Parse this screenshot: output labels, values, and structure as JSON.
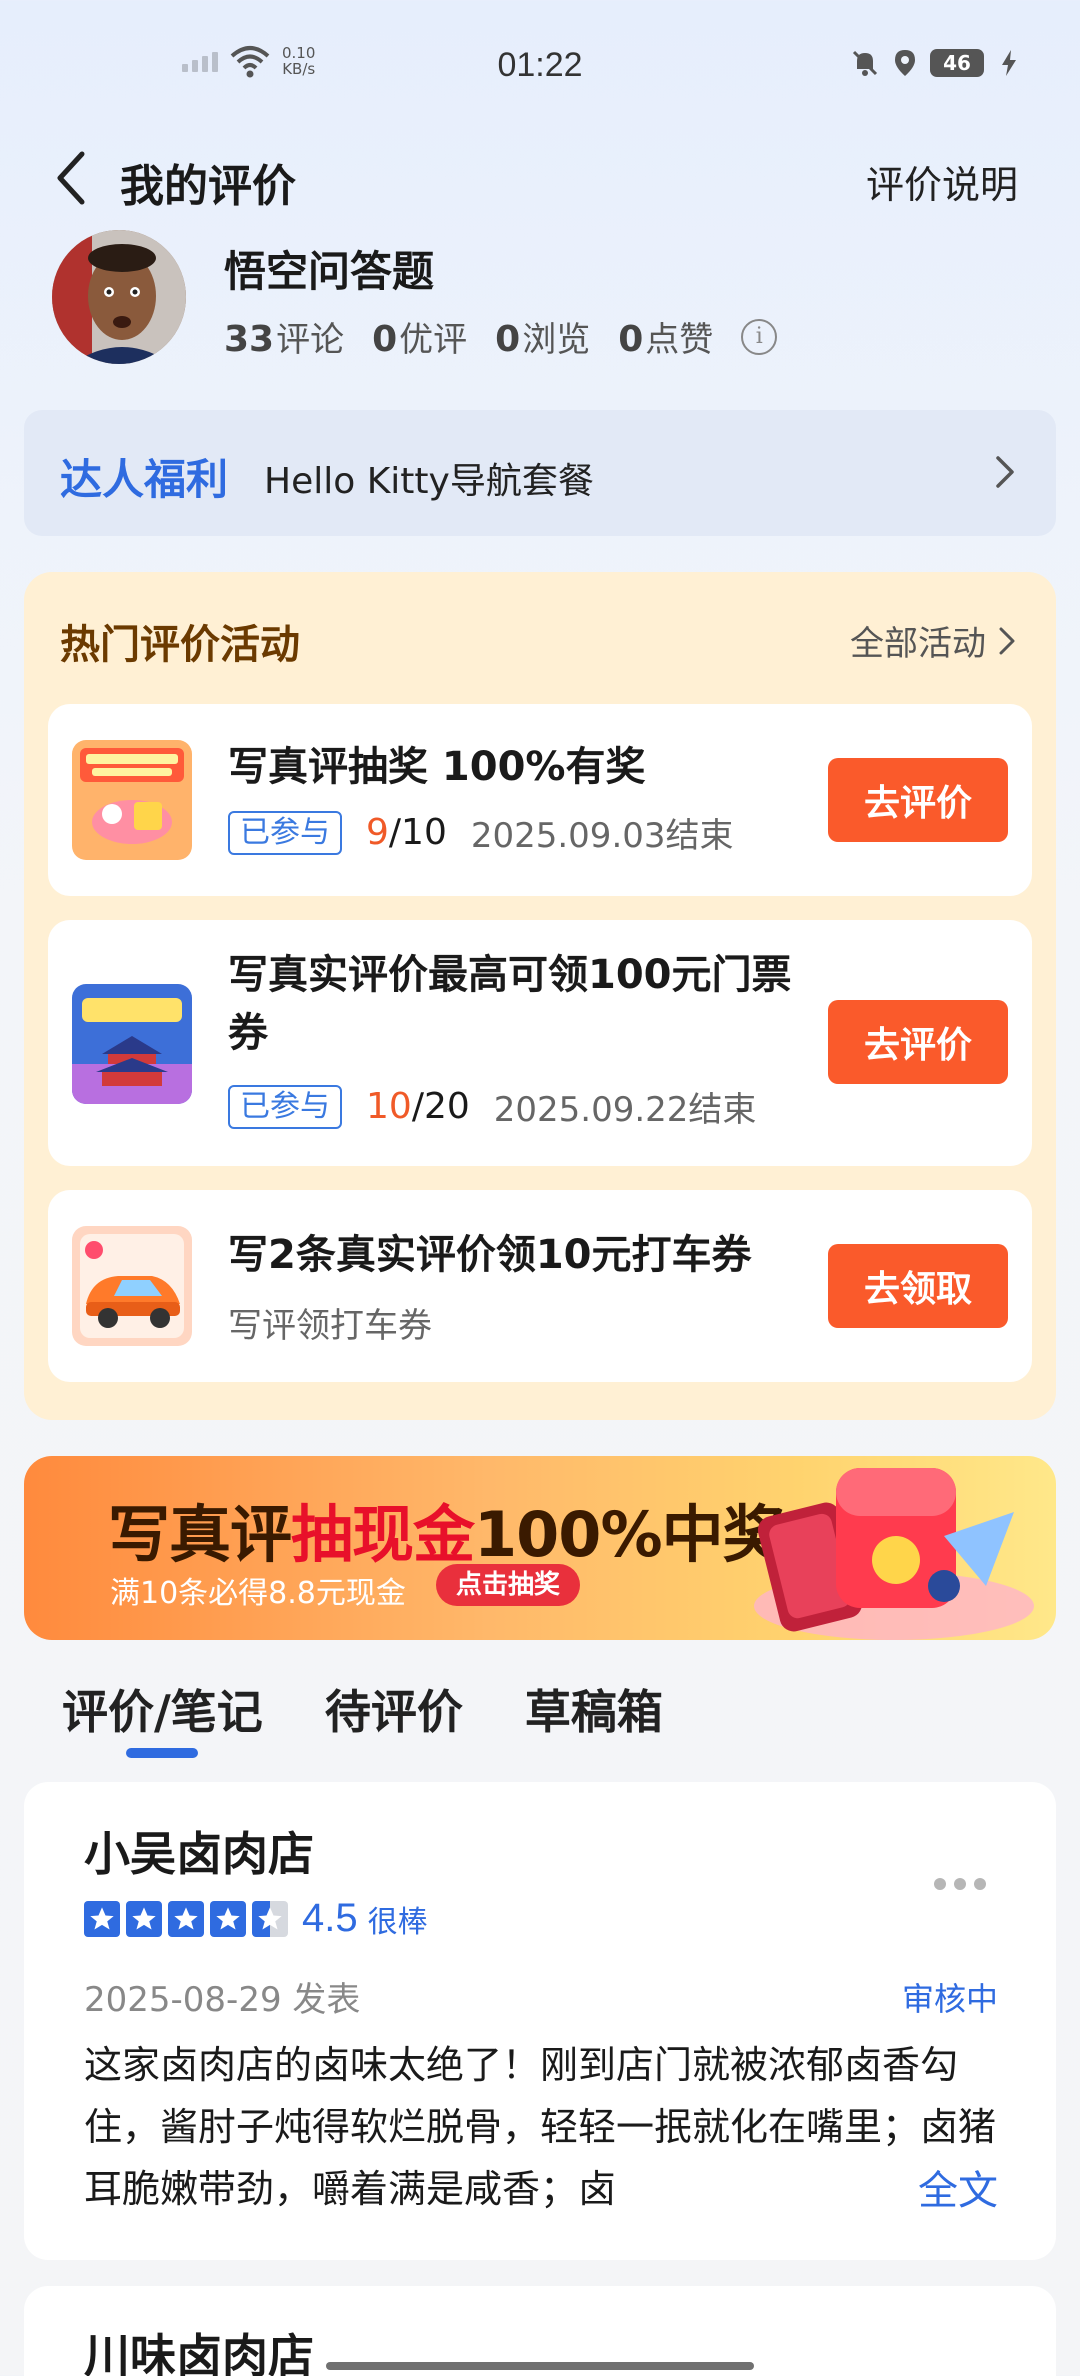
{
  "status_bar": {
    "time": "01:22",
    "net_speed_value": "0.10",
    "net_speed_unit": "KB/s",
    "battery": "46"
  },
  "navbar": {
    "title": "我的评价",
    "help_link": "评价说明"
  },
  "profile": {
    "name": "悟空问答题",
    "stats": [
      {
        "count": "33",
        "label": "评论"
      },
      {
        "count": "0",
        "label": "优评"
      },
      {
        "count": "0",
        "label": "浏览"
      },
      {
        "count": "0",
        "label": "点赞"
      }
    ]
  },
  "benefit": {
    "label": "达人福利",
    "text": "Hello Kitty导航套餐"
  },
  "activities": {
    "title": "热门评价活动",
    "all_link": "全部活动",
    "items": [
      {
        "name": "写真评抽奖 100%有奖",
        "tag": "已参与",
        "progress_current": "9",
        "progress_total": "/10",
        "deadline": "2025.09.03结束",
        "button": "去评价"
      },
      {
        "name": "写真实评价最高可领100元门票券",
        "tag": "已参与",
        "progress_current": "10",
        "progress_total": "/20",
        "deadline": "2025.09.22结束",
        "button": "去评价"
      },
      {
        "name": "写2条真实评价领10元打车券",
        "subtitle": "写评领打车券",
        "button": "去领取"
      }
    ]
  },
  "banner": {
    "title_part1": "写真评",
    "title_highlight": "抽现金",
    "title_part2": "100%中奖",
    "subtitle": "满10条必得8.8元现金",
    "cta": "点击抽奖"
  },
  "tabs": [
    {
      "label": "评价/笔记",
      "active": true
    },
    {
      "label": "待评价",
      "active": false
    },
    {
      "label": "草稿箱",
      "active": false
    }
  ],
  "reviews": [
    {
      "shop": "小吴卤肉店",
      "score": "4.5",
      "score_word": "很棒",
      "stars": 4.5,
      "date": "2025-08-29 发表",
      "status": "审核中",
      "text": "这家卤肉店的卤味太绝了！刚到店门就被浓郁卤香勾住，酱肘子炖得软烂脱骨，轻轻一抿就化在嘴里；卤猪耳脆嫩带劲，嚼着满是咸香；卤",
      "fulltext_link": "全文"
    },
    {
      "shop": "川味卤肉店"
    }
  ],
  "colors": {
    "accent_blue": "#2f6be0",
    "accent_orange": "#fa5a2b",
    "activity_bg": "#fff0d4"
  }
}
